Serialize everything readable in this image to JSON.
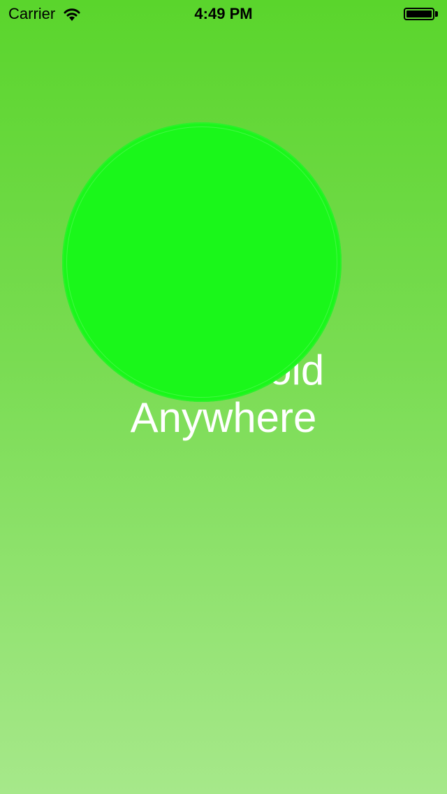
{
  "status_bar": {
    "carrier": "Carrier",
    "time": "4:49 PM",
    "wifi_icon": "wifi-icon",
    "battery_icon": "battery-icon",
    "battery_level": 1.0
  },
  "main": {
    "instruction_line1": "Tap + Hold",
    "instruction_line2": "Anywhere",
    "colors": {
      "background_top": "#5ad52c",
      "background_bottom": "#a6e88a",
      "circle": "#1af71a",
      "text": "#ffffff"
    }
  }
}
